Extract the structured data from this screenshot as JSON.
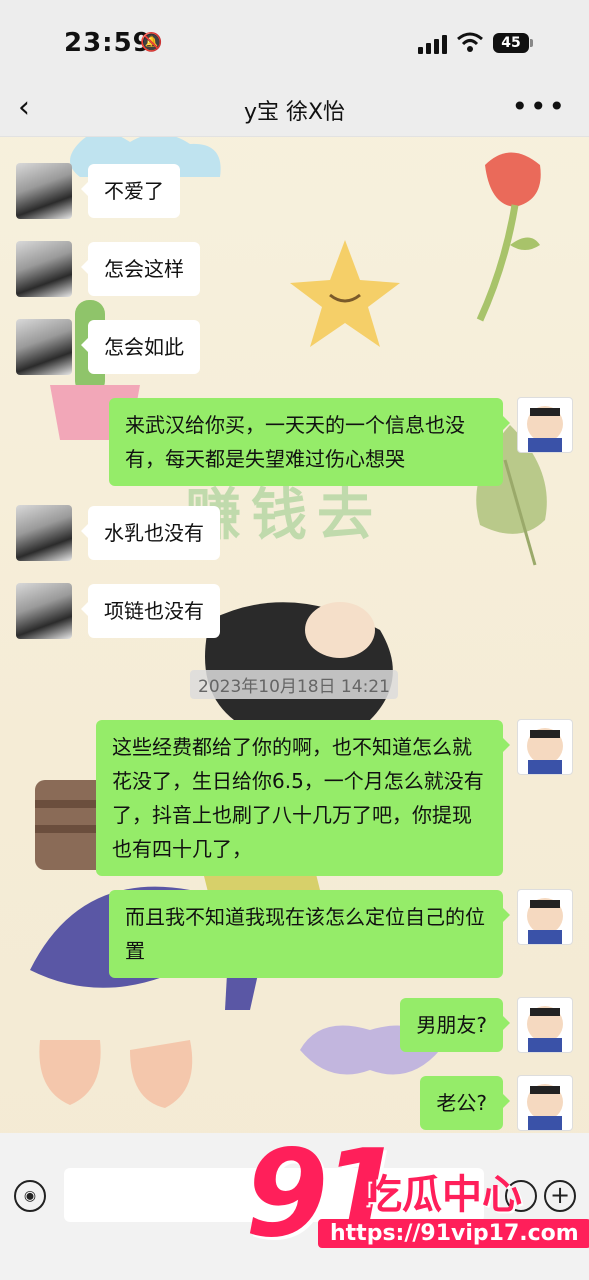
{
  "status_bar": {
    "time": "23:59",
    "battery": "45"
  },
  "header": {
    "title": "y宝 徐X怡"
  },
  "background": {
    "deco_text": "赚钱去"
  },
  "messages": [
    {
      "side": "in",
      "text": "不爱了"
    },
    {
      "side": "in",
      "text": "怎会这样"
    },
    {
      "side": "in",
      "text": "怎会如此"
    },
    {
      "side": "out",
      "text": "来武汉给你买，一天天的一个信息也没有，每天都是失望难过伤心想哭"
    },
    {
      "side": "in",
      "text": "水乳也没有"
    },
    {
      "side": "in",
      "text": "项链也没有"
    },
    {
      "side": "out",
      "text": "这些经费都给了你的啊，也不知道怎么就花没了，生日给你6.5，一个月怎么就没有了，抖音上也刷了八十几万了吧，你提现也有四十几了，"
    },
    {
      "side": "out",
      "text": "而且我不知道我现在该怎么定位自己的位置"
    },
    {
      "side": "out",
      "text": "男朋友?"
    },
    {
      "side": "out",
      "text": "老公?"
    }
  ],
  "timestamp": "2023年10月18日 14:21",
  "watermark": {
    "number": "91",
    "text": "吃瓜中心",
    "url": "https://91vip17.com"
  },
  "colors": {
    "sent_bubble": "#95ec69",
    "received_bubble": "#ffffff",
    "watermark": "#ff1f5a"
  }
}
